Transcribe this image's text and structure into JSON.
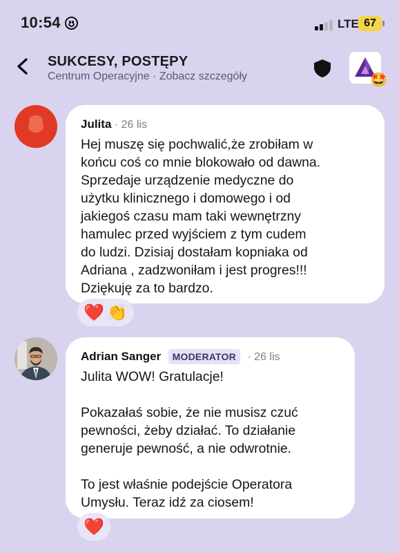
{
  "status": {
    "time": "10:54",
    "network": "LTE",
    "battery": "67"
  },
  "header": {
    "title": "SUKCESY, POSTĘPY",
    "subtitle": "Centrum Operacyjne · Zobacz szczegóły",
    "group_badge": "🤩"
  },
  "messages": [
    {
      "author": "Julita",
      "date": "· 26 lis",
      "text": "Hej muszę się pochwalić,że zrobiłam w\nkońcu coś co mnie blokowało od dawna.\nSprzedaje urządzenie medyczne do\nużytku klinicznego i domowego i od\njakiegoś czasu mam taki wewnętrzny\nhamulec przed wyjściem z tym cudem\ndo ludzi. Dzisiaj dostałam kopniaka od\nAdriana , zadzwoniłam i jest progres!!!\nDziękuję za to bardzo.",
      "reactions": [
        "❤️",
        "👏"
      ]
    },
    {
      "author": "Adrian Sanger",
      "badge": "MODERATOR",
      "date": "· 26 lis",
      "text": "Julita WOW! Gratulacje!\n\nPokazałaś sobie, że nie musisz czuć\npewności, żeby działać. To działanie\ngeneruje pewność, a nie odwrotnie.\n\nTo jest właśnie podejście Operatora\nUmysłu. Teraz idź za ciosem!",
      "reactions": [
        "❤️"
      ]
    }
  ],
  "colors": {
    "background": "#d9d3ef",
    "avatar_red": "#e03a26",
    "bubble": "#ffffff"
  }
}
